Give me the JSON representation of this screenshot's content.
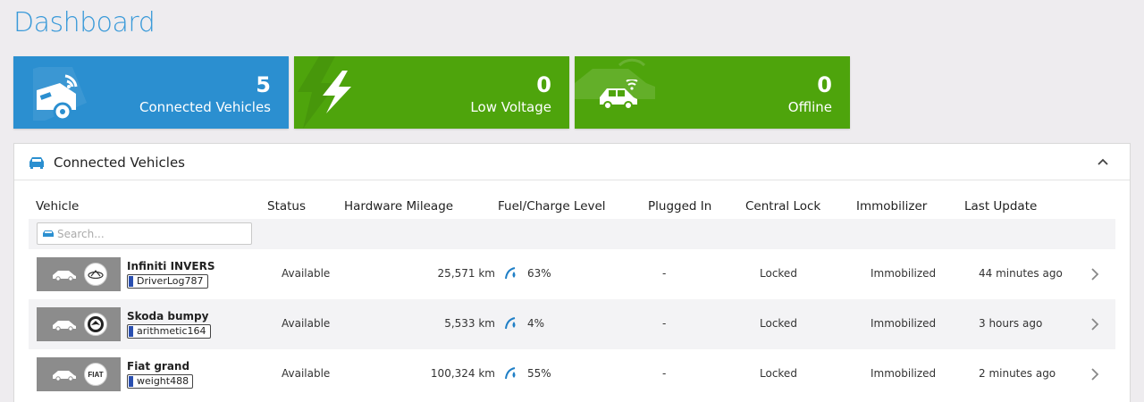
{
  "page": {
    "title": "Dashboard"
  },
  "tiles": [
    {
      "count": "5",
      "label": "Connected Vehicles",
      "color": "#2b8fd0",
      "icon": "car-wifi-icon"
    },
    {
      "count": "0",
      "label": "Low Voltage",
      "color": "#4ea40c",
      "icon": "lightning-icon"
    },
    {
      "count": "0",
      "label": "Offline",
      "color": "#4ea40c",
      "icon": "car-signal-icon"
    }
  ],
  "panel": {
    "title": "Connected Vehicles",
    "columns": [
      "Vehicle",
      "Status",
      "Hardware Mileage",
      "Fuel/Charge Level",
      "Plugged In",
      "Central Lock",
      "Immobilizer",
      "Last Update"
    ],
    "search_placeholder": "Search...",
    "rows": [
      {
        "name": "Infiniti INVERS",
        "tag": "DriverLog787",
        "brand_logo": "infiniti-logo-icon",
        "status": "Available",
        "mileage": "25,571 km",
        "fuel": "63%",
        "plugged": "-",
        "lock": "Locked",
        "immobilizer": "Immobilized",
        "last_update": "44 minutes ago"
      },
      {
        "name": "Skoda bumpy",
        "tag": "arithmetic164",
        "brand_logo": "skoda-logo-icon",
        "status": "Available",
        "mileage": "5,533 km",
        "fuel": "4%",
        "plugged": "-",
        "lock": "Locked",
        "immobilizer": "Immobilized",
        "last_update": "3 hours ago"
      },
      {
        "name": "Fiat grand",
        "tag": "weight488",
        "brand_logo": "fiat-logo-icon",
        "brand_text": "FIAT",
        "status": "Available",
        "mileage": "100,324 km",
        "fuel": "55%",
        "plugged": "-",
        "lock": "Locked",
        "immobilizer": "Immobilized",
        "last_update": "2 minutes ago"
      }
    ]
  },
  "colors": {
    "accent": "#3a9ad9",
    "blue_tile": "#2b8fd0",
    "green_tile": "#4ea40c",
    "fuel_icon": "#1f7fc6"
  }
}
